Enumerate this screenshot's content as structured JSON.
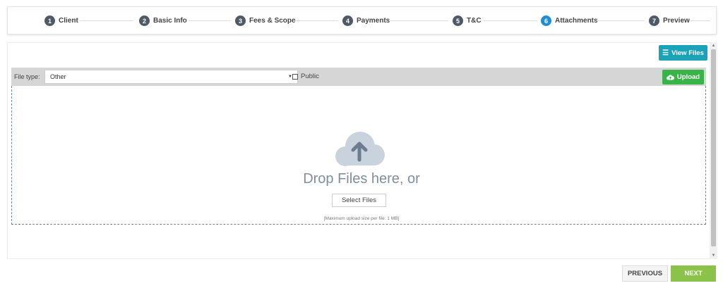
{
  "stepper": {
    "steps": [
      {
        "num": "1",
        "label": "Client"
      },
      {
        "num": "2",
        "label": "Basic Info"
      },
      {
        "num": "3",
        "label": "Fees & Scope"
      },
      {
        "num": "4",
        "label": "Payments"
      },
      {
        "num": "5",
        "label": "T&C"
      },
      {
        "num": "6",
        "label": "Attachments"
      },
      {
        "num": "7",
        "label": "Preview"
      }
    ],
    "active_step": 6
  },
  "toolbar": {
    "view_files_label": "View Files",
    "file_type_label": "File type:",
    "file_type_value": "Other",
    "public_label": "Public",
    "upload_label": "Upload"
  },
  "dropzone": {
    "icon": "cloud-upload-icon",
    "drop_text": "Drop Files here, or",
    "select_files_label": "Select Files",
    "max_size_text": "[Maximum upload size per file: 1 MB]"
  },
  "footer": {
    "previous_label": "PREVIOUS",
    "next_label": "NEXT"
  },
  "colors": {
    "step_badge": "#4e5a66",
    "step_active": "#1e8fd6",
    "view_files_button": "#1aa3b8",
    "upload_button": "#39b449",
    "next_button": "#8bc34a",
    "toolbar_bg": "#d6d6d6",
    "dropzone_border": "#6e86a0",
    "cloud_icon": "#c9d3dd"
  }
}
